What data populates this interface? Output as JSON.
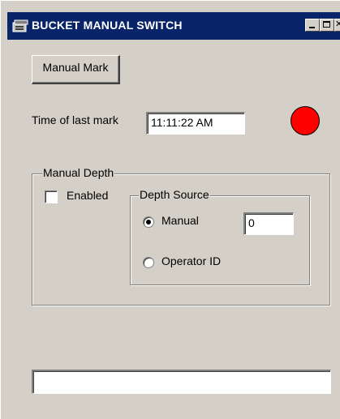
{
  "window": {
    "title": "BUCKET MANUAL SWITCH",
    "title_bg": "#0a246a",
    "icon": "app-window-icon"
  },
  "manual_mark": {
    "button_label": "Manual Mark"
  },
  "last_mark": {
    "label": "Time of last mark",
    "value": "11:11:22 AM",
    "indicator_color": "#ff0000"
  },
  "manual_depth": {
    "group_label": "Manual Depth",
    "enabled_label": "Enabled",
    "enabled_checked": false,
    "depth_source": {
      "group_label": "Depth Source",
      "options": [
        {
          "label": "Manual",
          "selected": true
        },
        {
          "label": "Operator ID",
          "selected": false
        }
      ],
      "manual_value": "0"
    }
  },
  "status_field": {
    "value": ""
  }
}
